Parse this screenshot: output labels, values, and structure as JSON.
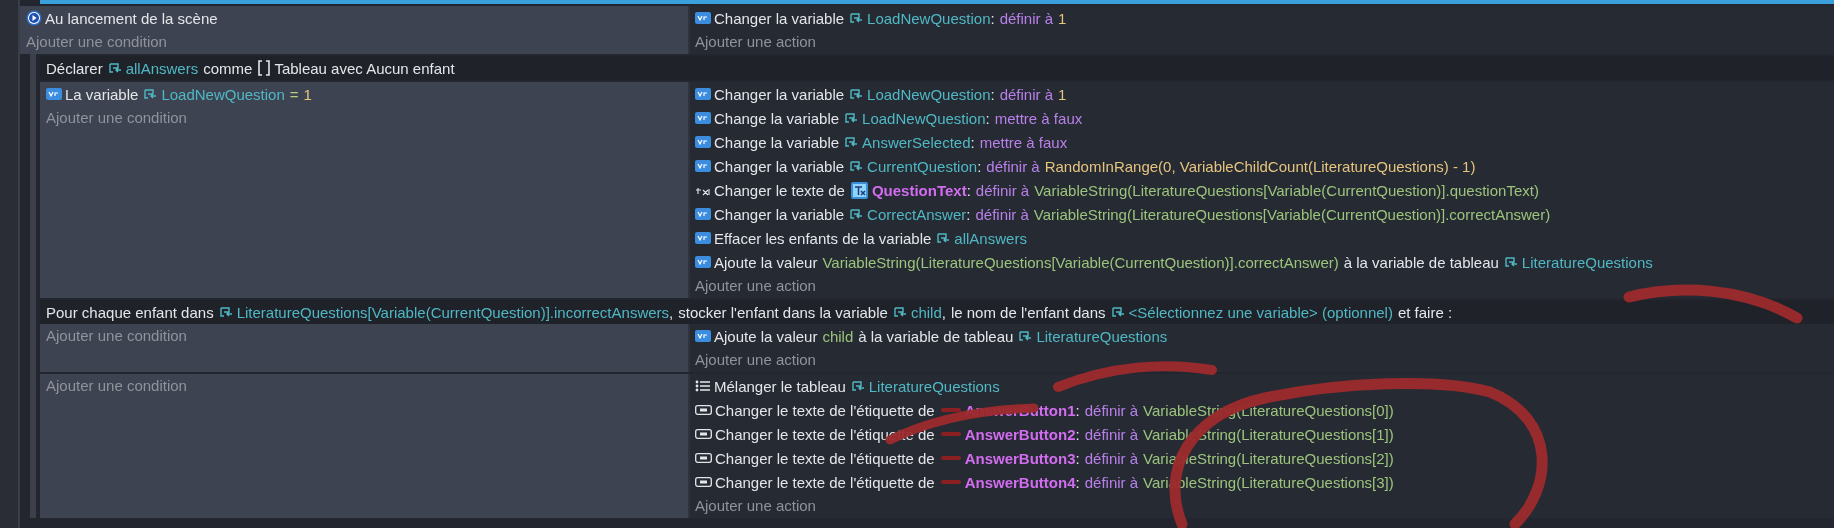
{
  "events": [
    {
      "kind": "standard",
      "conditions": [
        {
          "kind": "start",
          "parts": [
            {
              "kind": "text",
              "text": "Au lancement de la scène"
            }
          ]
        }
      ],
      "add_condition": "Ajouter une condition",
      "actions": [
        {
          "kind": "variable",
          "parts": [
            {
              "kind": "text",
              "text": "Changer la variable"
            },
            {
              "kind": "var",
              "text": "LoadNewQuestion"
            },
            {
              "kind": "punct",
              "text": ":"
            },
            {
              "kind": "op",
              "text": "définir à"
            },
            {
              "kind": "num",
              "text": "1"
            }
          ]
        }
      ],
      "add_action": "Ajouter une action",
      "children": [
        {
          "kind": "declaration",
          "parts": [
            {
              "kind": "text",
              "text": "Déclarer"
            },
            {
              "kind": "var",
              "text": "allAnswers"
            },
            {
              "kind": "text",
              "text": "comme"
            },
            {
              "kind": "type",
              "text": "Tableau avec Aucun enfant"
            }
          ]
        },
        {
          "kind": "standard",
          "conditions": [
            {
              "kind": "variable",
              "parts": [
                {
                  "kind": "text",
                  "text": "La variable"
                },
                {
                  "kind": "var",
                  "text": "LoadNewQuestion"
                },
                {
                  "kind": "compare",
                  "text": "="
                },
                {
                  "kind": "num",
                  "text": "1"
                }
              ]
            }
          ],
          "add_condition": "Ajouter une condition",
          "actions": [
            {
              "kind": "variable",
              "parts": [
                {
                  "kind": "text",
                  "text": "Changer la variable"
                },
                {
                  "kind": "var",
                  "text": "LoadNewQuestion"
                },
                {
                  "kind": "punct",
                  "text": ":"
                },
                {
                  "kind": "op",
                  "text": "définir à"
                },
                {
                  "kind": "num",
                  "text": "1"
                }
              ]
            },
            {
              "kind": "variable",
              "parts": [
                {
                  "kind": "text",
                  "text": "Change la variable"
                },
                {
                  "kind": "var",
                  "text": "LoadNewQuestion"
                },
                {
                  "kind": "punct",
                  "text": ":"
                },
                {
                  "kind": "op",
                  "text": "mettre à faux"
                }
              ]
            },
            {
              "kind": "variable",
              "parts": [
                {
                  "kind": "text",
                  "text": "Change la variable"
                },
                {
                  "kind": "var",
                  "text": "AnswerSelected"
                },
                {
                  "kind": "punct",
                  "text": ":"
                },
                {
                  "kind": "op",
                  "text": "mettre à faux"
                }
              ]
            },
            {
              "kind": "variable",
              "parts": [
                {
                  "kind": "text",
                  "text": "Changer la variable"
                },
                {
                  "kind": "var",
                  "text": "CurrentQuestion"
                },
                {
                  "kind": "punct",
                  "text": ":"
                },
                {
                  "kind": "op",
                  "text": "définir à"
                },
                {
                  "kind": "num",
                  "text": "RandomInRange(0, VariableChildCount(LiteratureQuestions) - 1)"
                }
              ]
            },
            {
              "kind": "text",
              "parts": [
                {
                  "kind": "text",
                  "text": "Changer le texte de"
                },
                {
                  "kind": "text_object",
                  "text": "QuestionText"
                },
                {
                  "kind": "punct",
                  "text": ":"
                },
                {
                  "kind": "op",
                  "text": "définir à"
                },
                {
                  "kind": "expr",
                  "text": "VariableString(LiteratureQuestions[Variable(CurrentQuestion)].questionText)"
                }
              ]
            },
            {
              "kind": "variable",
              "parts": [
                {
                  "kind": "text",
                  "text": "Changer la variable"
                },
                {
                  "kind": "var",
                  "text": "CorrectAnswer"
                },
                {
                  "kind": "punct",
                  "text": ":"
                },
                {
                  "kind": "op",
                  "text": "définir à"
                },
                {
                  "kind": "expr",
                  "text": "VariableString(LiteratureQuestions[Variable(CurrentQuestion)].correctAnswer)"
                }
              ]
            },
            {
              "kind": "variable",
              "parts": [
                {
                  "kind": "text",
                  "text": "Effacer les enfants de la variable"
                },
                {
                  "kind": "var",
                  "text": "allAnswers"
                }
              ]
            },
            {
              "kind": "variable",
              "parts": [
                {
                  "kind": "text",
                  "text": "Ajoute la valeur"
                },
                {
                  "kind": "expr",
                  "text": "VariableString(LiteratureQuestions[Variable(CurrentQuestion)].correctAnswer)"
                },
                {
                  "kind": "text",
                  "text": "à la variable de tableau"
                },
                {
                  "kind": "var",
                  "text": "LiteratureQuestions"
                }
              ]
            }
          ],
          "add_action": "Ajouter une action"
        },
        {
          "kind": "foreach",
          "parts": [
            {
              "kind": "text",
              "text": "Pour chaque enfant dans"
            },
            {
              "kind": "var",
              "text": "LiteratureQuestions[Variable(CurrentQuestion)].incorrectAnswers"
            },
            {
              "kind": "punct",
              "text": ","
            },
            {
              "kind": "text",
              "text": "stocker l'enfant dans la variable"
            },
            {
              "kind": "var",
              "text": "child"
            },
            {
              "kind": "punct",
              "text": ","
            },
            {
              "kind": "text",
              "text": "le nom de l'enfant dans"
            },
            {
              "kind": "var",
              "text": "<Sélectionnez une variable> (optionnel)"
            },
            {
              "kind": "text",
              "text": "et faire :"
            }
          ],
          "add_condition": "Ajouter une condition",
          "actions": [
            {
              "kind": "variable",
              "parts": [
                {
                  "kind": "text",
                  "text": "Ajoute la valeur"
                },
                {
                  "kind": "expr",
                  "text": "child"
                },
                {
                  "kind": "text",
                  "text": "à la variable de tableau"
                },
                {
                  "kind": "var",
                  "text": "LiteratureQuestions"
                }
              ]
            }
          ],
          "add_action": "Ajouter une action"
        },
        {
          "kind": "standard",
          "add_condition": "Ajouter une condition",
          "actions": [
            {
              "kind": "shuffle",
              "parts": [
                {
                  "kind": "text",
                  "text": "Mélanger le tableau"
                },
                {
                  "kind": "var",
                  "text": "LiteratureQuestions"
                }
              ]
            },
            {
              "kind": "button",
              "parts": [
                {
                  "kind": "text",
                  "text": "Changer le texte de l'étiquette de"
                },
                {
                  "kind": "button_object",
                  "text": "AnswerButton1"
                },
                {
                  "kind": "punct",
                  "text": ":"
                },
                {
                  "kind": "op",
                  "text": "définir à"
                },
                {
                  "kind": "expr",
                  "text": "VariableString(LiteratureQuestions[0])"
                }
              ]
            },
            {
              "kind": "button",
              "parts": [
                {
                  "kind": "text",
                  "text": "Changer le texte de l'étiquette de"
                },
                {
                  "kind": "button_object",
                  "text": "AnswerButton2"
                },
                {
                  "kind": "punct",
                  "text": ":"
                },
                {
                  "kind": "op",
                  "text": "définir à"
                },
                {
                  "kind": "expr",
                  "text": "VariableString(LiteratureQuestions[1])"
                }
              ]
            },
            {
              "kind": "button",
              "parts": [
                {
                  "kind": "text",
                  "text": "Changer le texte de l'étiquette de"
                },
                {
                  "kind": "button_object",
                  "text": "AnswerButton3"
                },
                {
                  "kind": "punct",
                  "text": ":"
                },
                {
                  "kind": "op",
                  "text": "définir à"
                },
                {
                  "kind": "expr",
                  "text": "VariableString(LiteratureQuestions[2])"
                }
              ]
            },
            {
              "kind": "button",
              "parts": [
                {
                  "kind": "text",
                  "text": "Changer le texte de l'étiquette de"
                },
                {
                  "kind": "button_object",
                  "text": "AnswerButton4"
                },
                {
                  "kind": "punct",
                  "text": ":"
                },
                {
                  "kind": "op",
                  "text": "définir à"
                },
                {
                  "kind": "expr",
                  "text": "VariableString(LiteratureQuestions[3])"
                }
              ]
            }
          ],
          "add_action": "Ajouter une action"
        }
      ]
    }
  ]
}
